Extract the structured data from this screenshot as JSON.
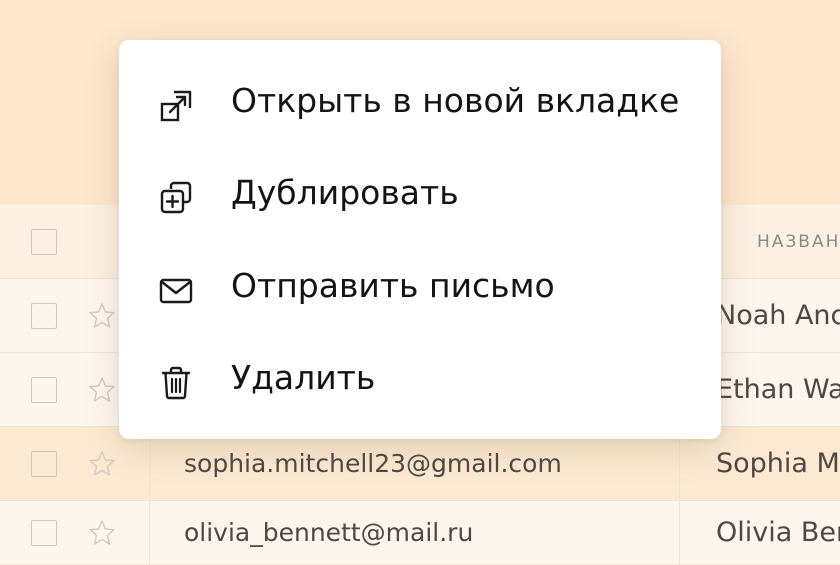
{
  "context_menu": {
    "items": [
      {
        "label": "Открыть в новой вкладке",
        "icon": "open-in-new-tab-icon"
      },
      {
        "label": "Дублировать",
        "icon": "duplicate-icon"
      },
      {
        "label": "Отправить письмо",
        "icon": "mail-icon"
      },
      {
        "label": "Удалить",
        "icon": "trash-icon"
      }
    ]
  },
  "table": {
    "header": {
      "name_column": "НАЗВАН"
    },
    "rows": [
      {
        "email": "",
        "name": "Noah Anc"
      },
      {
        "email": "",
        "name": "Ethan Wa"
      },
      {
        "email": "sophia.mitchell23@gmail.com",
        "name": "Sophia M"
      },
      {
        "email": "olivia_bennett@mail.ru",
        "name": "Olivia Ben"
      }
    ]
  },
  "colors": {
    "top_background": "#fde7cd",
    "table_background": "#fdf6ee",
    "highlighted_row": "#fde9d2",
    "menu_background": "#ffffff",
    "menu_text": "#141414"
  }
}
